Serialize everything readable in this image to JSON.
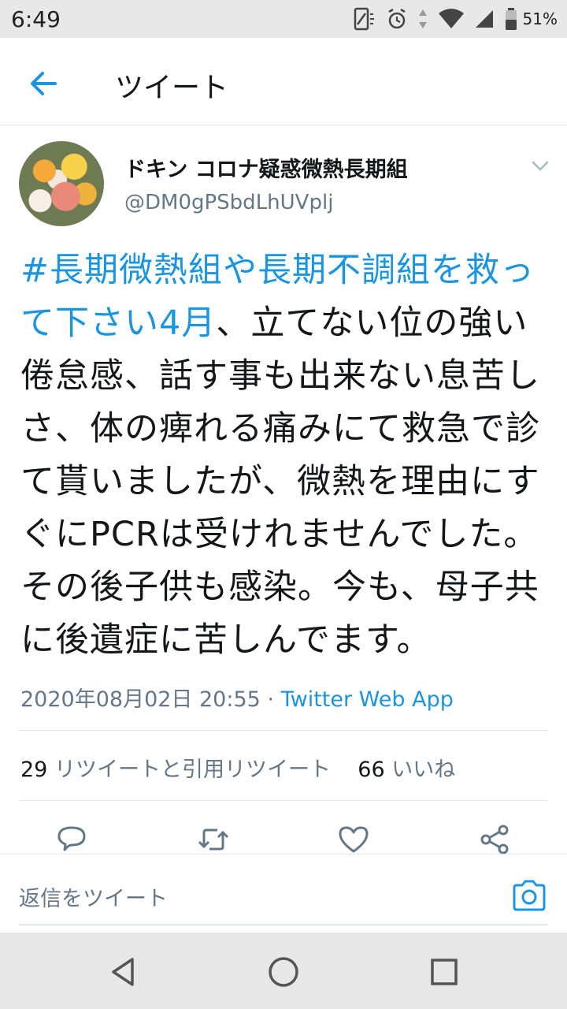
{
  "status_bar": {
    "time": "6:49",
    "battery": "51%",
    "icons": [
      "nfc-icon",
      "alarm-icon",
      "data-arrows-icon",
      "wifi-icon",
      "signal-icon",
      "battery-icon"
    ]
  },
  "header": {
    "title": "ツイート",
    "back_icon": "arrow-left-icon"
  },
  "tweet": {
    "author_name": "ドキン コロナ疑惑微熱長期組",
    "author_handle": "@DM0gPSbdLhUVplj",
    "hashtag": "#長期微熱組や長期不調組を救って下さい4月",
    "body": "、立てない位の強い倦怠感、話す事も出来ない息苦しさ、体の痺れる痛みにて救急で診て貰いましたが、微熱を理由にすぐにPCRは受けれませんでした。その後子供も感染。今も、母子共に後遺症に苦しんでます。",
    "timestamp": "2020年08月02日 20:55",
    "separator": "·",
    "source": "Twitter Web App",
    "retweets_count": "29",
    "retweets_label": "リツイートと引用リツイート",
    "likes_count": "66",
    "likes_label": "いいね",
    "accent_color": "#1b95e0"
  },
  "reply": {
    "placeholder": "返信をツイート",
    "camera_icon": "camera-icon"
  },
  "actions": [
    "reply-icon",
    "retweet-icon",
    "like-icon",
    "share-icon"
  ],
  "navigation": [
    "back-triangle-icon",
    "home-circle-icon",
    "recents-square-icon"
  ]
}
